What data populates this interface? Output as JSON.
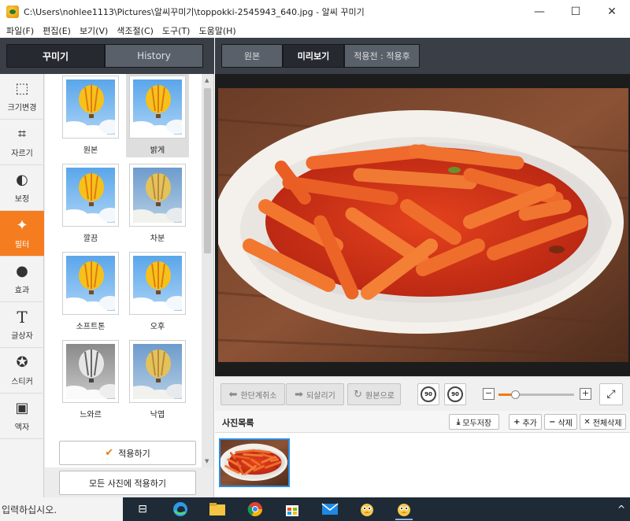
{
  "window": {
    "title": "C:\\Users\\nohlee1113\\Pictures\\알씨꾸미기\\toppokki-2545943_640.jpg - 알씨 꾸미기",
    "minimize": "—",
    "maximize": "☐",
    "close": "✕"
  },
  "menu": [
    "파일(F)",
    "편집(E)",
    "보기(V)",
    "색조절(C)",
    "도구(T)",
    "도움말(H)"
  ],
  "left_tabs": {
    "decorate": "꾸미기",
    "history": "History"
  },
  "tools": [
    {
      "label": "크기변경",
      "icon": "resize-icon",
      "glyph": "⬚"
    },
    {
      "label": "자르기",
      "icon": "crop-icon",
      "glyph": "⌗"
    },
    {
      "label": "보정",
      "icon": "contrast-icon",
      "glyph": "◐"
    },
    {
      "label": "필터",
      "icon": "magic-wand-icon",
      "glyph": "✦"
    },
    {
      "label": "효과",
      "icon": "drop-icon",
      "glyph": "●"
    },
    {
      "label": "글상자",
      "icon": "text-icon",
      "glyph": "T"
    },
    {
      "label": "스티커",
      "icon": "sticker-icon",
      "glyph": "✪"
    },
    {
      "label": "액자",
      "icon": "frame-icon",
      "glyph": "▣"
    }
  ],
  "filters": [
    {
      "label": "원본",
      "style": "original"
    },
    {
      "label": "밝게",
      "style": "bright"
    },
    {
      "label": "깔끔",
      "style": "clean"
    },
    {
      "label": "차분",
      "style": "calm"
    },
    {
      "label": "소프트톤",
      "style": "soft"
    },
    {
      "label": "오후",
      "style": "afternoon"
    },
    {
      "label": "느와르",
      "style": "noir"
    },
    {
      "label": "낙엽",
      "style": "autumn"
    }
  ],
  "selected_filter": "밝게",
  "apply_buttons": {
    "apply": "적용하기",
    "apply_all": "모든 사진에 적용하기"
  },
  "view_tabs": {
    "original": "원본",
    "preview": "미리보기",
    "compare": "적용전 : 적용후"
  },
  "edit_toolbar": {
    "undo": "한단계취소",
    "redo": "되살리기",
    "restore": "원본으로",
    "rotate_left": "90",
    "rotate_right": "90",
    "zoom_out": "−",
    "zoom_in": "+",
    "fit": "⤢"
  },
  "zoom_level": 0.22,
  "photo_list": {
    "title": "사진목록",
    "save_all": "모두저장",
    "add": "추가",
    "delete": "삭제",
    "delete_all": "전체삭제"
  },
  "taskbar": {
    "search_placeholder": "입력하십시오.",
    "tray": "^"
  },
  "colors": {
    "accent": "#f57c1f",
    "panel_dark": "#3a3f47",
    "selection_blue": "#2a8ee6"
  }
}
